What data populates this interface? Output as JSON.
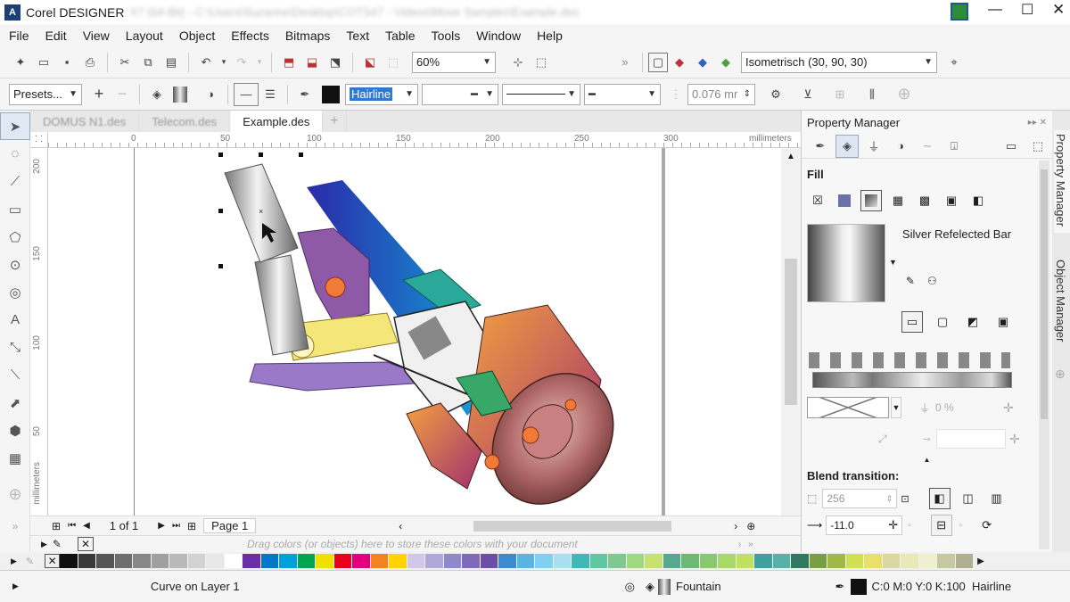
{
  "app": {
    "title": "Corel DESIGNER",
    "title_obscured": "X7 (64-Bit) - C:\\Users\\Suzanne\\Desktop\\COTS47 - Videos\\Move Samples\\Example.des"
  },
  "menu": [
    "File",
    "Edit",
    "View",
    "Layout",
    "Object",
    "Effects",
    "Bitmaps",
    "Text",
    "Table",
    "Tools",
    "Window",
    "Help"
  ],
  "toolbar": {
    "zoom": "60%",
    "projection": "Isometrisch (30, 90, 30)"
  },
  "propbar": {
    "presets": "Presets...",
    "outline_width": "Hairline",
    "nudge": "0.076 mr"
  },
  "tabs": [
    {
      "label": "DOMUS N1.des",
      "active": false
    },
    {
      "label": "Telecom.des",
      "active": false
    },
    {
      "label": "Example.des",
      "active": true
    }
  ],
  "ruler": {
    "h_unit": "millimeters",
    "h_ticks": [
      "0",
      "50",
      "100",
      "150",
      "200",
      "250",
      "300"
    ],
    "v_unit": "millimeters",
    "v_ticks": [
      "200",
      "150",
      "100",
      "50"
    ]
  },
  "pagebar": {
    "page_count": "1 of 1",
    "page_tab": "Page 1"
  },
  "docpal": {
    "hint": "Drag colors (or objects) here to store these colors with your document"
  },
  "status": {
    "selection": "Curve on Layer 1",
    "fill": "Fountain",
    "outline": "C:0 M:0 Y:0 K:100  Hairline"
  },
  "panel": {
    "title": "Property Manager",
    "fill_heading": "Fill",
    "fill_name": "Silver Refelected Bar",
    "transparency": "0 %",
    "blend_heading": "Blend transition:",
    "steps": "256",
    "angle": "-11.0"
  },
  "sidetabs": [
    "Property Manager",
    "Object Manager"
  ],
  "palette": [
    "#111111",
    "#3a3a3a",
    "#555555",
    "#6e6e6e",
    "#878787",
    "#a0a0a0",
    "#b9b9b9",
    "#d2d2d2",
    "#e8e8e8",
    "#ffffff",
    "#6b2fa8",
    "#0078c8",
    "#00a0d8",
    "#00a550",
    "#f0e000",
    "#e8001c",
    "#e4007c",
    "#f58220",
    "#ffd400",
    "#cfc8e8",
    "#b0a8d8",
    "#9088c8",
    "#7f6ab8",
    "#6c4ea8",
    "#3c8ad0",
    "#5ab4e0",
    "#80d0f0",
    "#a8e0f0",
    "#40b8b8",
    "#60c8a0",
    "#80c890",
    "#a0d880",
    "#c8e070",
    "#58a890",
    "#70b878",
    "#88c870",
    "#a8d868",
    "#c0e060",
    "#40a0a0",
    "#58b0a8",
    "#307860",
    "#78a040",
    "#a0b848",
    "#d0e050",
    "#e8e068",
    "#d8d8a0",
    "#e8e8b8",
    "#f0f0d0",
    "#c8c8a0",
    "#b0b090"
  ]
}
